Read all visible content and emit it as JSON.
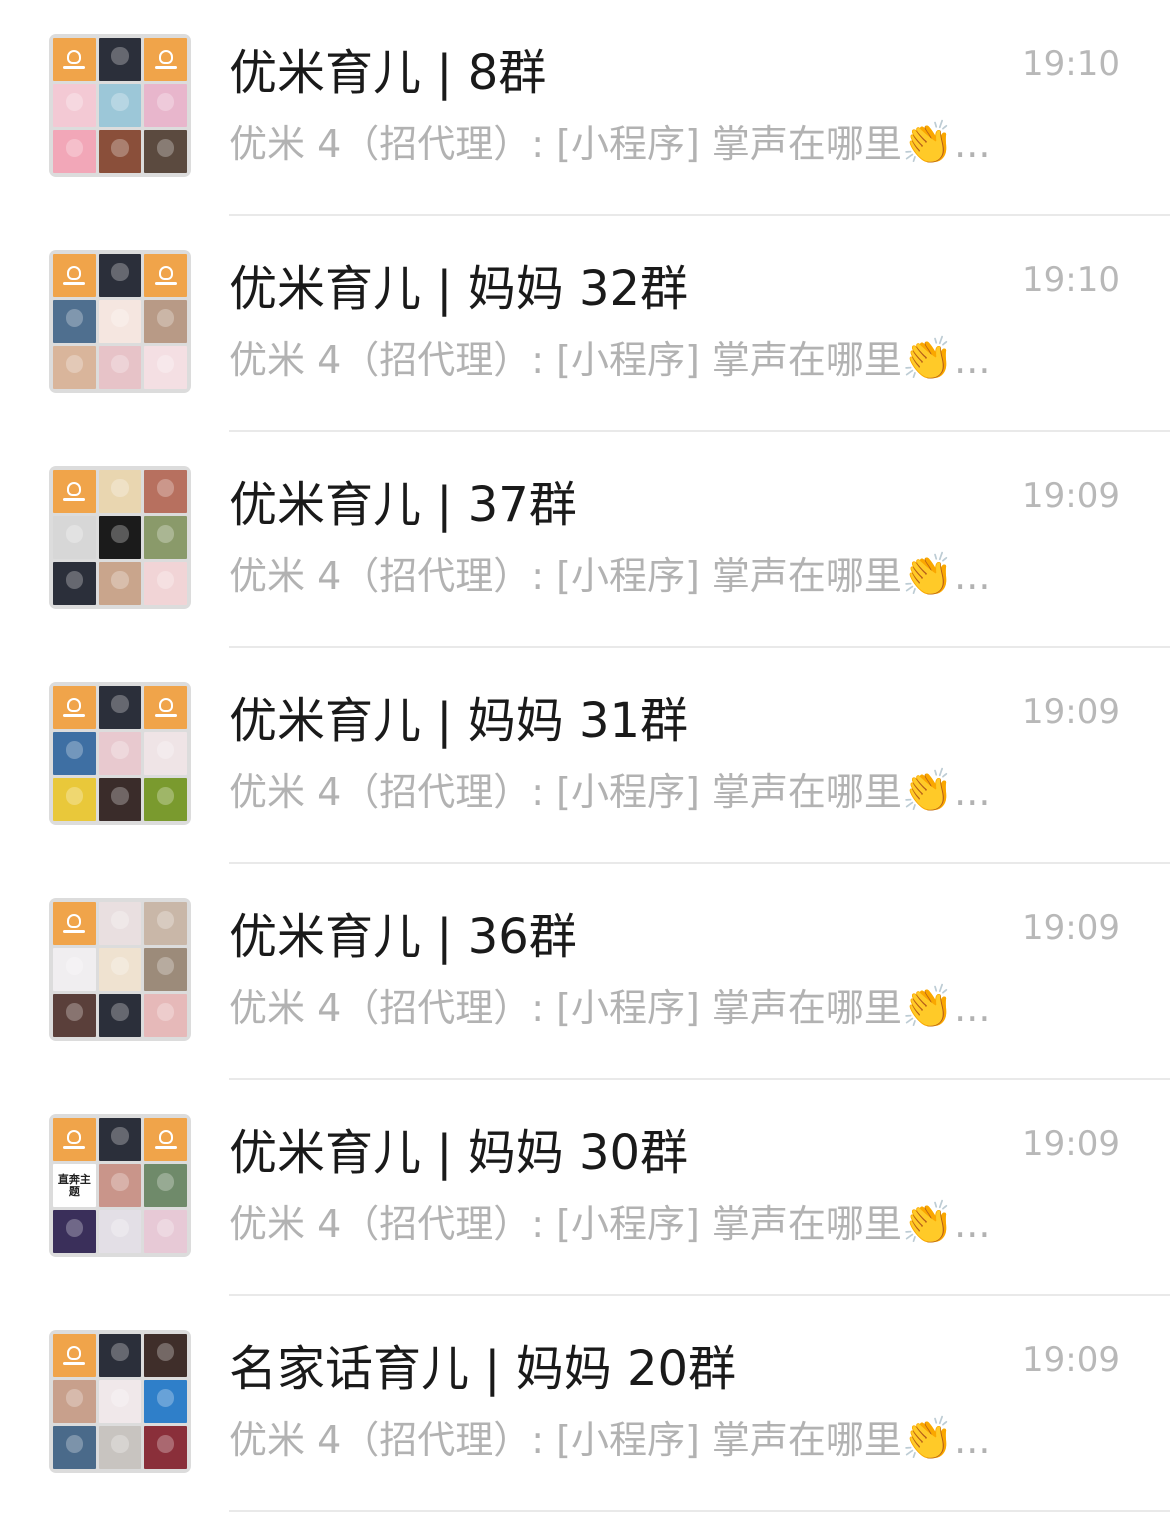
{
  "chats": [
    {
      "title": "优米育儿 | 8群",
      "time": "19:10",
      "preview": "优米 4（招代理）: [小程序] 掌声在哪里",
      "preview_emoji": "👏",
      "preview_ellipsis": "...",
      "avatar_tiles": [
        {
          "kind": "logo"
        },
        {
          "kind": "photo",
          "color": "#2b2f3a"
        },
        {
          "kind": "logo"
        },
        {
          "kind": "photo",
          "color": "#f3c9d4"
        },
        {
          "kind": "photo",
          "color": "#9cc7d8"
        },
        {
          "kind": "photo",
          "color": "#e8b6cc"
        },
        {
          "kind": "photo",
          "color": "#f2a7b8"
        },
        {
          "kind": "photo",
          "color": "#8a4f3a"
        },
        {
          "kind": "photo",
          "color": "#5b4a3f"
        }
      ]
    },
    {
      "title": "优米育儿 | 妈妈 32群",
      "time": "19:10",
      "preview": "优米 4（招代理）: [小程序] 掌声在哪里",
      "preview_emoji": "👏",
      "preview_ellipsis": "...",
      "avatar_tiles": [
        {
          "kind": "logo"
        },
        {
          "kind": "photo",
          "color": "#2b2f3a"
        },
        {
          "kind": "logo"
        },
        {
          "kind": "photo",
          "color": "#4f6f8f"
        },
        {
          "kind": "photo",
          "color": "#f5e6e0"
        },
        {
          "kind": "photo",
          "color": "#b89a86"
        },
        {
          "kind": "photo",
          "color": "#d9b59b"
        },
        {
          "kind": "photo",
          "color": "#e7c3c8"
        },
        {
          "kind": "photo",
          "color": "#f4dfe3"
        }
      ]
    },
    {
      "title": "优米育儿 | 37群",
      "time": "19:09",
      "preview": "优米 4（招代理）: [小程序] 掌声在哪里",
      "preview_emoji": "👏",
      "preview_ellipsis": "...",
      "avatar_tiles": [
        {
          "kind": "logo"
        },
        {
          "kind": "photo",
          "color": "#e9d6b0"
        },
        {
          "kind": "photo",
          "color": "#b7705f"
        },
        {
          "kind": "photo",
          "color": "#d7d7d7"
        },
        {
          "kind": "photo",
          "color": "#1b1b1b"
        },
        {
          "kind": "photo",
          "color": "#8a9a6a"
        },
        {
          "kind": "photo",
          "color": "#2b2f3a"
        },
        {
          "kind": "photo",
          "color": "#c9a58c"
        },
        {
          "kind": "photo",
          "color": "#f1d4d6"
        }
      ]
    },
    {
      "title": "优米育儿 | 妈妈 31群",
      "time": "19:09",
      "preview": "优米 4（招代理）: [小程序] 掌声在哪里",
      "preview_emoji": "👏",
      "preview_ellipsis": "...",
      "avatar_tiles": [
        {
          "kind": "logo"
        },
        {
          "kind": "photo",
          "color": "#2b2f3a"
        },
        {
          "kind": "logo"
        },
        {
          "kind": "photo",
          "color": "#3e6fa3"
        },
        {
          "kind": "photo",
          "color": "#e8c9cf"
        },
        {
          "kind": "photo",
          "color": "#efe4e6"
        },
        {
          "kind": "photo",
          "color": "#e9c83a"
        },
        {
          "kind": "photo",
          "color": "#3a2c2a"
        },
        {
          "kind": "photo",
          "color": "#7a9a2e"
        }
      ]
    },
    {
      "title": "优米育儿 | 36群",
      "time": "19:09",
      "preview": "优米 4（招代理）: [小程序] 掌声在哪里",
      "preview_emoji": "👏",
      "preview_ellipsis": "...",
      "avatar_tiles": [
        {
          "kind": "logo"
        },
        {
          "kind": "photo",
          "color": "#e9dfe0"
        },
        {
          "kind": "photo",
          "color": "#c9b7a8"
        },
        {
          "kind": "photo",
          "color": "#f0eef0"
        },
        {
          "kind": "photo",
          "color": "#efe2d0"
        },
        {
          "kind": "photo",
          "color": "#9c8b7a"
        },
        {
          "kind": "photo",
          "color": "#5a3f3a"
        },
        {
          "kind": "photo",
          "color": "#2b2f3a"
        },
        {
          "kind": "photo",
          "color": "#e6b9b9"
        }
      ]
    },
    {
      "title": "优米育儿 | 妈妈 30群",
      "time": "19:09",
      "preview": "优米 4（招代理）: [小程序] 掌声在哪里",
      "preview_emoji": "👏",
      "preview_ellipsis": "...",
      "avatar_tiles": [
        {
          "kind": "logo"
        },
        {
          "kind": "photo",
          "color": "#2b2f3a"
        },
        {
          "kind": "logo"
        },
        {
          "kind": "text",
          "text": "直奔主题"
        },
        {
          "kind": "photo",
          "color": "#c9958a"
        },
        {
          "kind": "photo",
          "color": "#6f8a6a"
        },
        {
          "kind": "photo",
          "color": "#3a2f5a"
        },
        {
          "kind": "photo",
          "color": "#e3dfe6"
        },
        {
          "kind": "photo",
          "color": "#e7c9d6"
        }
      ]
    },
    {
      "title": "名家话育儿 | 妈妈 20群",
      "time": "19:09",
      "preview": "优米 4（招代理）: [小程序] 掌声在哪里",
      "preview_emoji": "👏",
      "preview_ellipsis": "...",
      "avatar_tiles": [
        {
          "kind": "logo"
        },
        {
          "kind": "photo",
          "color": "#2b2f3a"
        },
        {
          "kind": "photo",
          "color": "#3f2e2a"
        },
        {
          "kind": "photo",
          "color": "#c8a08c"
        },
        {
          "kind": "photo",
          "color": "#f0e8ea"
        },
        {
          "kind": "photo",
          "color": "#2f7fc9"
        },
        {
          "kind": "photo",
          "color": "#4a6a8a"
        },
        {
          "kind": "photo",
          "color": "#c8c4c0"
        },
        {
          "kind": "photo",
          "color": "#8a2f3a"
        }
      ]
    }
  ]
}
